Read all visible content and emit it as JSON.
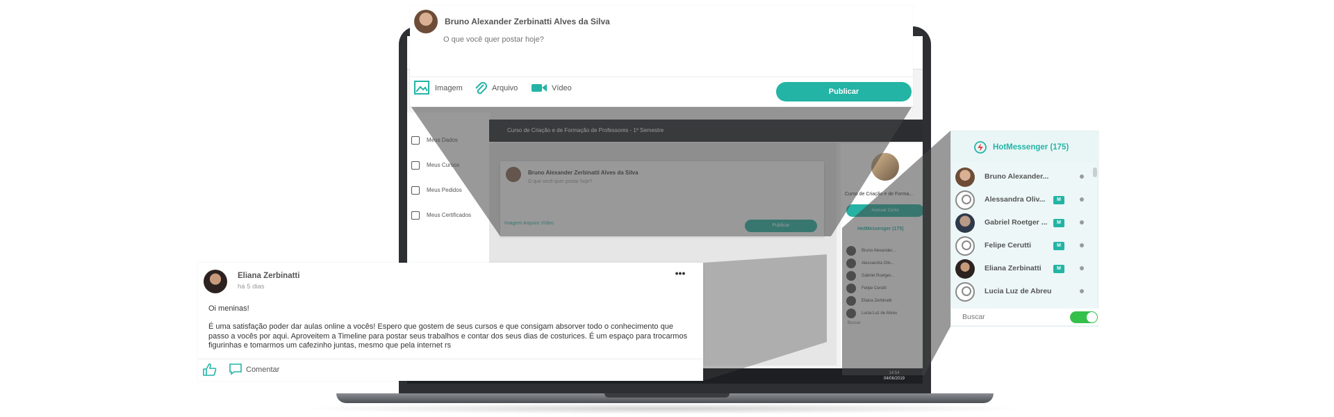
{
  "top_post": {
    "author": "Bruno Alexander Zerbinatti Alves da Silva",
    "placeholder": "O que você quer postar hoje?",
    "attachments": [
      {
        "label": "Imagem",
        "icon": "image-icon"
      },
      {
        "label": "Arquivo",
        "icon": "paperclip-icon"
      },
      {
        "label": "Vídeo",
        "icon": "video-camera-icon"
      }
    ],
    "publish_label": "Publicar"
  },
  "feed_post": {
    "author": "Eliana Zerbinatti",
    "time": "há 5 dias",
    "greeting": "Oi meninas!",
    "body": "É uma satisfação poder dar aulas online a vocês! Espero que gostem de seus cursos e que consigam absorver todo o conhecimento que passo a vocês por aqui. Aproveitem a Timeline para postar seus trabalhos e contar dos seus dias de costurices. É um espaço para trocarmos figurinhas e tomarmos um cafezinho juntas, mesmo que pela internet rs",
    "more_label": "•••",
    "comment_label": "Comentar"
  },
  "messenger": {
    "title": "HotMessenger (175)",
    "contacts": [
      {
        "name": "Bruno Alexander...",
        "badge": "",
        "avatar": "photo"
      },
      {
        "name": "Alessandra Oliv...",
        "badge": "M",
        "avatar": "generic"
      },
      {
        "name": "Gabriel Roetger ...",
        "badge": "M",
        "avatar": "photo"
      },
      {
        "name": "Felipe Cerutti",
        "badge": "M",
        "avatar": "generic"
      },
      {
        "name": "Eliana Zerbinatti",
        "badge": "M",
        "avatar": "photo"
      },
      {
        "name": "Lucia Luz de Abreu",
        "badge": "",
        "avatar": "generic"
      }
    ],
    "search_placeholder": "Buscar"
  },
  "inner_screen": {
    "sidebar": [
      "Meus Dados",
      "Meus Cursos",
      "Meus Pedidos",
      "Meus Certificados"
    ],
    "course_bar": "Curso de Criação e de Formação de Professores - 1º Semestre",
    "post_author": "Bruno Alexander Zerbinatti Alves da Silva",
    "post_placeholder": "O que você quer postar hoje?",
    "post_actions": "Imagem   Arquivo   Vídeo",
    "post_publish": "Publicar",
    "course_name": "Curso de Criação e de Forma...",
    "course_button": "Acessar Curso",
    "hot_title": "HotMessenger (175)",
    "contacts": [
      "Bruno Alexander...",
      "Alessandra Oliv...",
      "Gabriel Roetger...",
      "Felipe Cerutti",
      "Eliana Zerbinatti",
      "Lucia Luz de Abreu"
    ],
    "search": "Buscar",
    "clock_time": "14:54",
    "clock_date": "04/06/2019"
  },
  "colors": {
    "accent": "#23b4a6",
    "toggle_on": "#34c04a",
    "dark_bar": "#2b2d31"
  }
}
